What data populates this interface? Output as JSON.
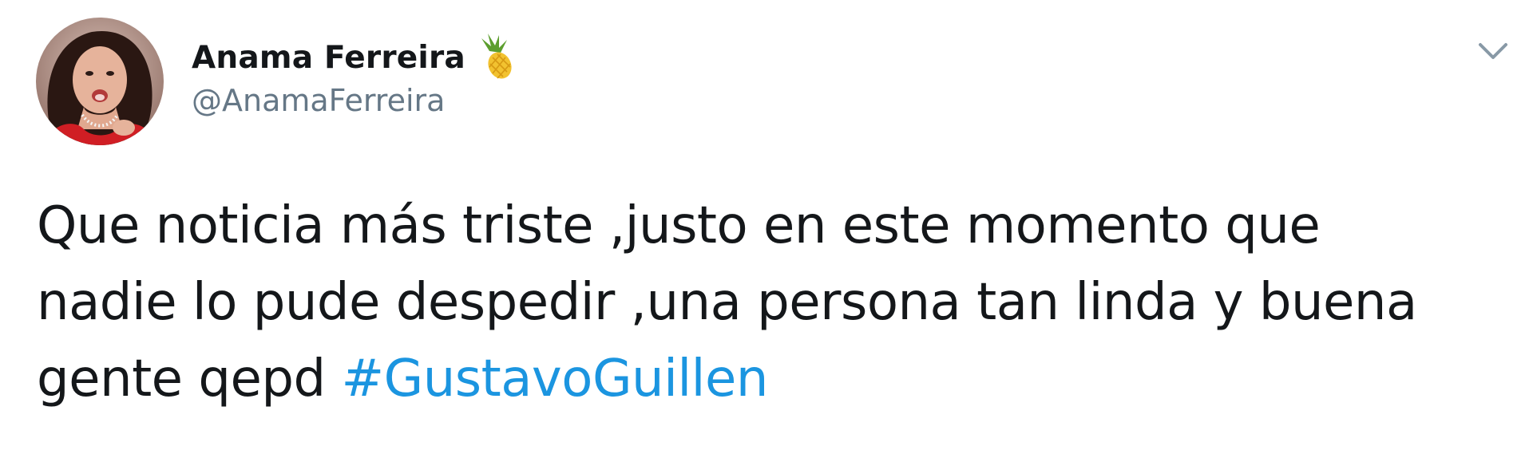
{
  "author": {
    "display_name": "Anama Ferreira",
    "handle": "@AnamaFerreira",
    "name_emoji": "pineapple-icon",
    "avatar": "profile-photo"
  },
  "menu": {
    "icon": "chevron-down-icon"
  },
  "tweet": {
    "line1": "Que noticia más triste ,justo en este momento que",
    "line2": "nadie lo pude despedir ,una persona tan linda y buena",
    "line3": "gente qepd ",
    "hashtag": "#GustavoGuillen"
  },
  "colors": {
    "text": "#14171a",
    "secondary_text": "#657786",
    "link": "#1b95e0",
    "chevron": "#8899a6"
  }
}
